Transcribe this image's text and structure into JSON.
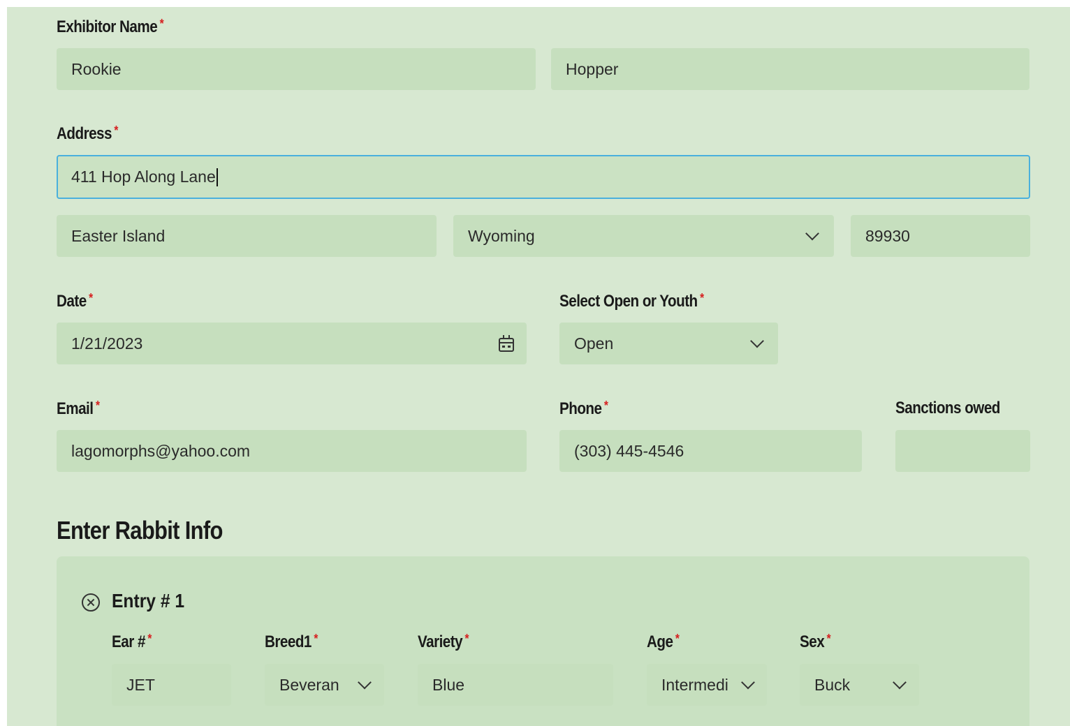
{
  "labels": {
    "exhibitor_name": "Exhibitor Name",
    "address": "Address",
    "date": "Date",
    "open_or_youth": "Select Open or Youth",
    "email": "Email",
    "phone": "Phone",
    "sanctions_owed": "Sanctions owed",
    "required_marker": "*"
  },
  "exhibitor": {
    "first_name": "Rookie",
    "last_name": "Hopper"
  },
  "address": {
    "street": "411 Hop Along Lane",
    "city": "Easter Island",
    "state": "Wyoming",
    "zip": "89930"
  },
  "date": {
    "value": "1/21/2023"
  },
  "open_or_youth": {
    "selected": "Open"
  },
  "contact": {
    "email": "lagomorphs@yahoo.com",
    "phone": "(303) 445-4546",
    "sanctions_owed": ""
  },
  "rabbit_section": {
    "title": "Enter Rabbit Info",
    "entry": {
      "title": "Entry # 1",
      "labels": {
        "ear": "Ear #",
        "breed": "Breed1",
        "variety": "Variety",
        "age": "Age",
        "sex": "Sex"
      },
      "values": {
        "ear": "JET",
        "breed": "Beveran",
        "variety": "Blue",
        "age": "Intermedi",
        "sex": "Buck"
      }
    }
  },
  "icons": {
    "remove_entry": "x-circle-icon",
    "calendar": "calendar-icon",
    "dropdown": "chevron-down-icon"
  },
  "colors": {
    "background": "#d7e8d1",
    "field": "#c6dfbe",
    "focus_border": "#4ab0dd",
    "required": "#d62020"
  }
}
